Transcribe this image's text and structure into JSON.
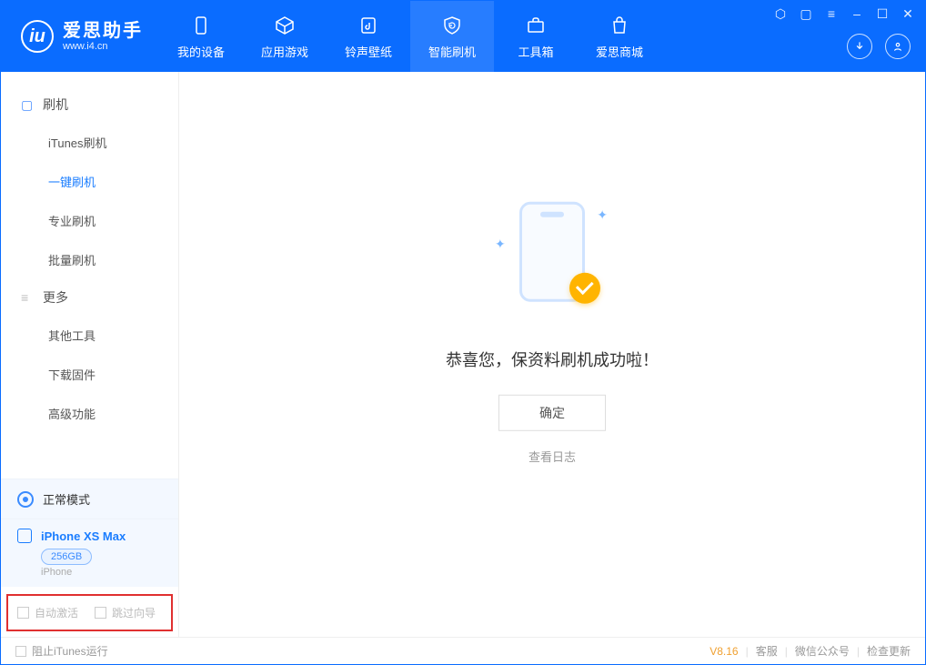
{
  "app": {
    "title": "爱思助手",
    "subtitle": "www.i4.cn"
  },
  "tabs": {
    "device": "我的设备",
    "apps": "应用游戏",
    "ringtone": "铃声壁纸",
    "flash": "智能刷机",
    "toolbox": "工具箱",
    "store": "爱思商城"
  },
  "sidebar": {
    "group_flash": "刷机",
    "items_flash": {
      "itunes": "iTunes刷机",
      "oneclick": "一键刷机",
      "pro": "专业刷机",
      "batch": "批量刷机"
    },
    "group_more": "更多",
    "items_more": {
      "other": "其他工具",
      "firmware": "下载固件",
      "advanced": "高级功能"
    }
  },
  "mode": {
    "label": "正常模式"
  },
  "device": {
    "name": "iPhone XS Max",
    "storage": "256GB",
    "type": "iPhone"
  },
  "options": {
    "auto_activate": "自动激活",
    "skip_guide": "跳过向导"
  },
  "result": {
    "title": "恭喜您，保资料刷机成功啦！",
    "ok": "确定",
    "log": "查看日志"
  },
  "footer": {
    "block_itunes": "阻止iTunes运行",
    "version": "V8.16",
    "support": "客服",
    "wechat": "微信公众号",
    "update": "检查更新"
  }
}
